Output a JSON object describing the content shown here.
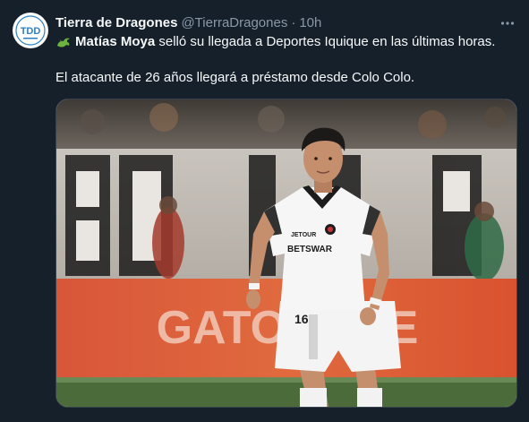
{
  "author": {
    "display_name": "Tierra de Dragones",
    "handle": "@TierraDragones",
    "separator": "·",
    "time": "10h",
    "avatar_text": "TDD",
    "avatar_color": "#2f7fc1"
  },
  "tweet": {
    "emoji_icon": "dragon-icon",
    "mention": "Matías Moya",
    "line1_rest": "selló su llegada a Deportes Iquique en las últimas horas.",
    "line2": "El atacante de 26 años llegará a préstamo desde Colo Colo."
  },
  "media": {
    "banner_text": "GATORADE",
    "jersey_sponsor": "JETOUR",
    "jersey_main_sponsor": "BETSWAR",
    "shorts_number": "16"
  },
  "colors": {
    "background": "#15202b",
    "text_primary": "#f7f9f9",
    "text_secondary": "#8b98a5",
    "border": "#38444d"
  }
}
